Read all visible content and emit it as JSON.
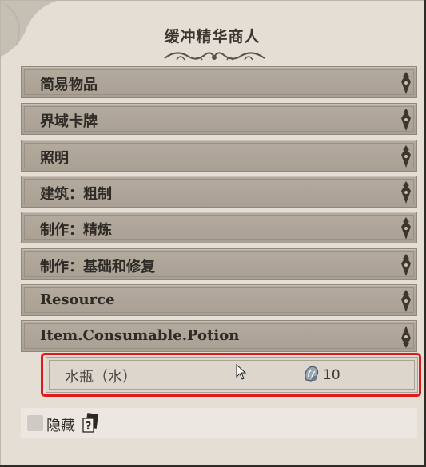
{
  "window": {
    "title": "缓冲精华商人"
  },
  "categories": [
    {
      "label": "简易物品",
      "expanded": false
    },
    {
      "label": "界域卡牌",
      "expanded": false
    },
    {
      "label": "照明",
      "expanded": false
    },
    {
      "label": "建筑：粗制",
      "expanded": false
    },
    {
      "label": "制作：精炼",
      "expanded": false
    },
    {
      "label": "制作：基础和修复",
      "expanded": false
    },
    {
      "label": "Resource",
      "expanded": false
    },
    {
      "label": "Item.Consumable.Potion",
      "expanded": true
    }
  ],
  "items": [
    {
      "name": "水瓶（水）",
      "cost": "10",
      "cost_icon": "essence-icon"
    }
  ],
  "footer": {
    "hide_label": "隐藏",
    "hide_checked": false,
    "help_icon": "help-book-icon"
  },
  "colors": {
    "highlight": "#e01b1b",
    "category_bg": "#ada497",
    "panel_bg": "#e4ded5"
  }
}
